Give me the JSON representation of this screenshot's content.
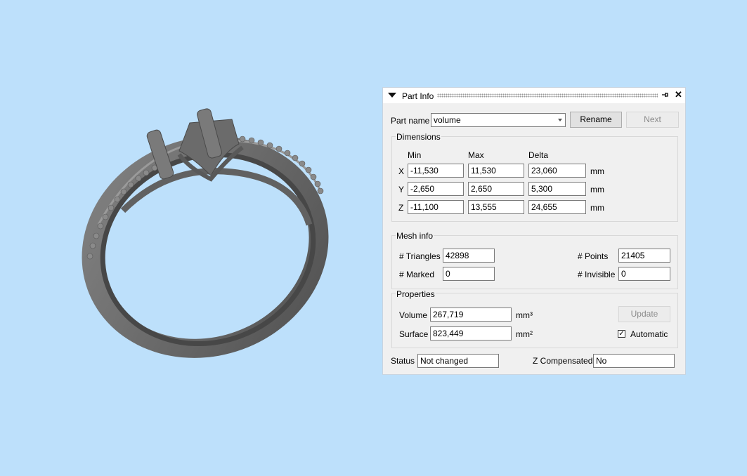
{
  "panel": {
    "title": "Part Info",
    "part_name_label": "Part name",
    "part_name_value": "volume",
    "rename_label": "Rename",
    "next_label": "Next"
  },
  "dimensions": {
    "title": "Dimensions",
    "col_min": "Min",
    "col_max": "Max",
    "col_delta": "Delta",
    "rows": [
      {
        "axis": "X",
        "min": "-11,530",
        "max": "11,530",
        "delta": "23,060",
        "unit": "mm"
      },
      {
        "axis": "Y",
        "min": "-2,650",
        "max": "2,650",
        "delta": "5,300",
        "unit": "mm"
      },
      {
        "axis": "Z",
        "min": "-11,100",
        "max": "13,555",
        "delta": "24,655",
        "unit": "mm"
      }
    ]
  },
  "mesh": {
    "title": "Mesh info",
    "triangles_label": "# Triangles",
    "triangles_value": "42898",
    "points_label": "# Points",
    "points_value": "21405",
    "marked_label": "# Marked",
    "marked_value": "0",
    "invisible_label": "# Invisible",
    "invisible_value": "0"
  },
  "properties": {
    "title": "Properties",
    "volume_label": "Volume",
    "volume_value": "267,719",
    "volume_unit": "mm³",
    "surface_label": "Surface",
    "surface_value": "823,449",
    "surface_unit": "mm²",
    "update_label": "Update",
    "automatic_label": "Automatic",
    "automatic_checked": true
  },
  "status": {
    "status_label": "Status",
    "status_value": "Not changed",
    "zcomp_label": "Z Compensated",
    "zcomp_value": "No"
  },
  "colors": {
    "background": "#bde0fb",
    "panel": "#f0f0f0",
    "model": "#6d6d6d"
  },
  "icons": [
    "collapse-triangle-icon",
    "pin-icon",
    "close-icon",
    "combo-arrow-icon",
    "checkmark-icon"
  ]
}
